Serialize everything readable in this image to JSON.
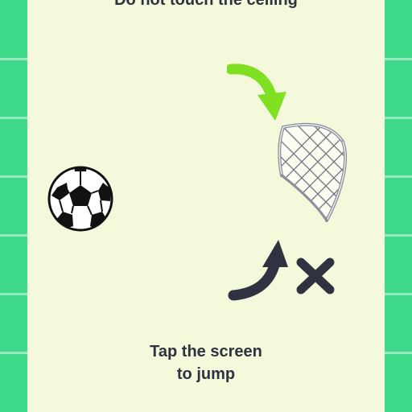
{
  "instructions": {
    "ceiling_warning": "Do not touch the ceiling",
    "tap_line_1": "Tap the screen",
    "tap_line_2": "to jump"
  },
  "icons": {
    "ball": "soccer-ball-icon",
    "goal": "goal-net-icon",
    "correct_arrow": "curved-arrow-down-icon",
    "wrong_arrow": "curved-arrow-up-icon",
    "wrong_mark": "cross-icon"
  },
  "colors": {
    "background": "#f3f9da",
    "walls": "#3ed98a",
    "correct_arrow": "#7ee021",
    "wrong_arrow": "#2f3240",
    "text": "#2f3240"
  }
}
